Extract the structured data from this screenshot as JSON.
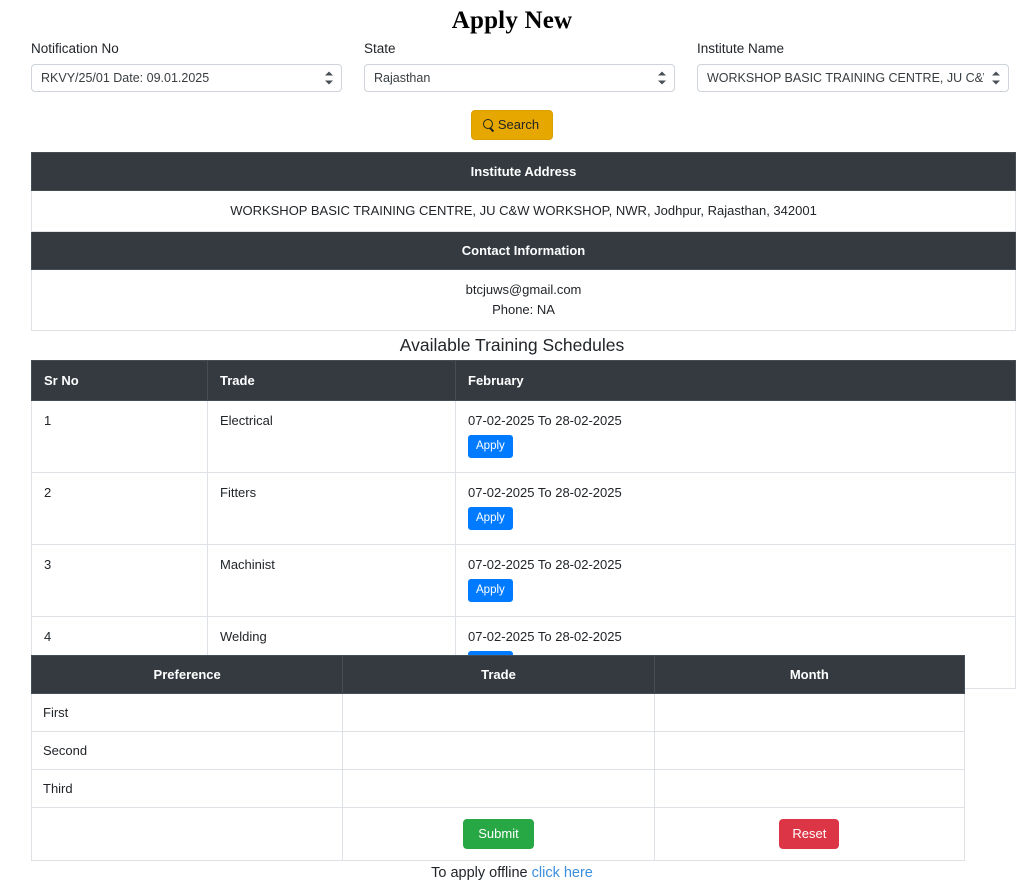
{
  "header": {
    "title": "Apply New"
  },
  "filters": {
    "notification": {
      "label": "Notification No",
      "value": "RKVY/25/01 Date: 09.01.2025"
    },
    "state": {
      "label": "State",
      "value": "Rajasthan"
    },
    "institute": {
      "label": "Institute Name",
      "value": "WORKSHOP BASIC TRAINING CENTRE, JU C&W WC"
    },
    "search_button": "Search",
    "search_icon": "search-icon"
  },
  "institute_info": {
    "address_header": "Institute Address",
    "address_value": "WORKSHOP BASIC TRAINING CENTRE, JU C&W WORKSHOP, NWR, Jodhpur, Rajasthan, 342001",
    "contact_header": "Contact Information",
    "contact_email": "btcjuws@gmail.com",
    "contact_phone": "Phone: NA"
  },
  "schedules": {
    "heading": "Available Training Schedules",
    "columns": [
      "Sr No",
      "Trade",
      "February"
    ],
    "apply_label": "Apply",
    "rows": [
      {
        "sr": "1",
        "trade": "Electrical",
        "dates": "07-02-2025 To 28-02-2025"
      },
      {
        "sr": "2",
        "trade": "Fitters",
        "dates": "07-02-2025 To 28-02-2025"
      },
      {
        "sr": "3",
        "trade": "Machinist",
        "dates": "07-02-2025 To 28-02-2025"
      },
      {
        "sr": "4",
        "trade": "Welding",
        "dates": "07-02-2025 To 28-02-2025"
      }
    ]
  },
  "preferences": {
    "columns": [
      "Preference",
      "Trade",
      "Month"
    ],
    "rows": [
      {
        "preference": "First",
        "trade": "",
        "month": ""
      },
      {
        "preference": "Second",
        "trade": "",
        "month": ""
      },
      {
        "preference": "Third",
        "trade": "",
        "month": ""
      }
    ],
    "submit_label": "Submit",
    "reset_label": "Reset"
  },
  "footer": {
    "text": "To apply offline",
    "link_text": "click here"
  },
  "colors": {
    "table_header": "#343a40",
    "search_button": "#e6a800",
    "apply_button": "#007bff",
    "submit_button": "#28a745",
    "reset_button": "#dc3545",
    "link": "#3b8fdd"
  }
}
